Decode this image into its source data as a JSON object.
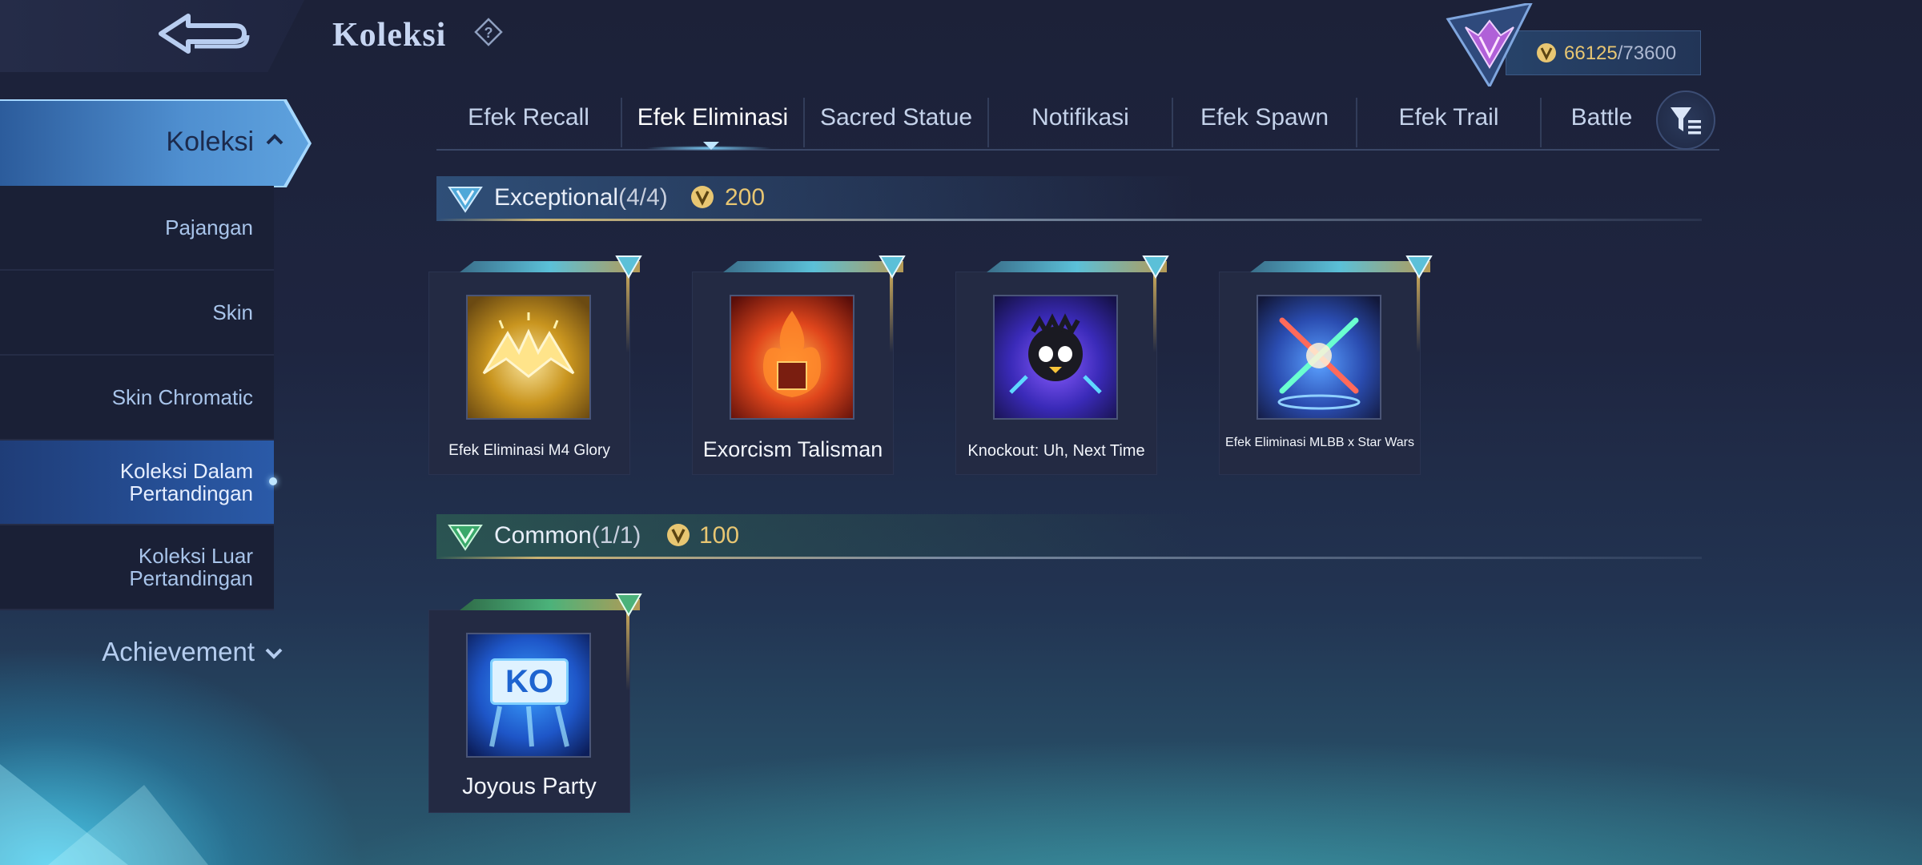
{
  "header": {
    "title": "Koleksi",
    "currency": {
      "current": "66125",
      "max": "/73600"
    }
  },
  "sidebar": {
    "main_label": "Koleksi",
    "items": [
      {
        "label": "Pajangan"
      },
      {
        "label": "Skin"
      },
      {
        "label": "Skin Chromatic"
      },
      {
        "label": "Koleksi Dalam Pertandingan",
        "active": true
      },
      {
        "label": "Koleksi Luar Pertandingan"
      }
    ],
    "achievement": "Achievement"
  },
  "tabs": [
    "Efek Recall",
    "Efek Eliminasi",
    "Sacred Statue",
    "Notifikasi",
    "Efek Spawn",
    "Efek Trail",
    "Battle"
  ],
  "active_tab": "Efek Eliminasi",
  "sections": [
    {
      "title": "Exceptional",
      "count": "(4/4)",
      "price": "200",
      "items": [
        {
          "name": "Efek Eliminasi M4 Glory",
          "icon": "m4-glory-thumb"
        },
        {
          "name": "Exorcism Talisman",
          "icon": "exorcism-talisman-thumb"
        },
        {
          "name": "Knockout: Uh, Next Time",
          "icon": "knockout-thumb"
        },
        {
          "name": "Efek Eliminasi MLBB x Star Wars",
          "icon": "star-wars-thumb"
        }
      ]
    },
    {
      "title": "Common",
      "count": "(1/1)",
      "price": "100",
      "items": [
        {
          "name": "Joyous Party",
          "icon": "joyous-party-thumb",
          "thumb_text": "KO"
        }
      ]
    }
  ],
  "colors": {
    "gold": "#e8c672",
    "accent_blue": "#5ea2de"
  }
}
